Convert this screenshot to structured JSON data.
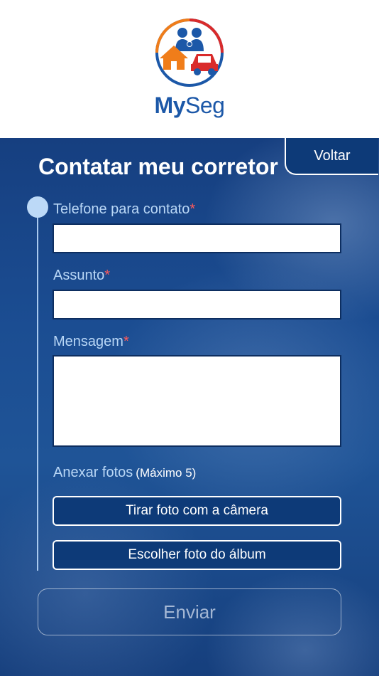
{
  "app": {
    "brand_my": "My",
    "brand_seg": "Seg"
  },
  "header": {
    "logo_icon": "family-house-car-logo-icon"
  },
  "page": {
    "title": "Contatar meu corretor",
    "back_label": "Voltar"
  },
  "form": {
    "phone": {
      "label": "Telefone para contato",
      "required_mark": "*",
      "value": ""
    },
    "subject": {
      "label": "Assunto",
      "required_mark": "*",
      "value": ""
    },
    "message": {
      "label": "Mensagem",
      "required_mark": "*",
      "value": ""
    },
    "photos": {
      "label": "Anexar fotos",
      "max_note": "(Máximo 5)",
      "camera_label": "Tirar foto com a câmera",
      "album_label": "Escolher foto do álbum"
    },
    "submit_label": "Enviar"
  },
  "colors": {
    "accent_orange": "#f07d1a",
    "brand_blue": "#1c58a8",
    "car_red": "#d92b2b",
    "label_blue": "#b9d7f6",
    "required_red": "#ff5a5a"
  }
}
